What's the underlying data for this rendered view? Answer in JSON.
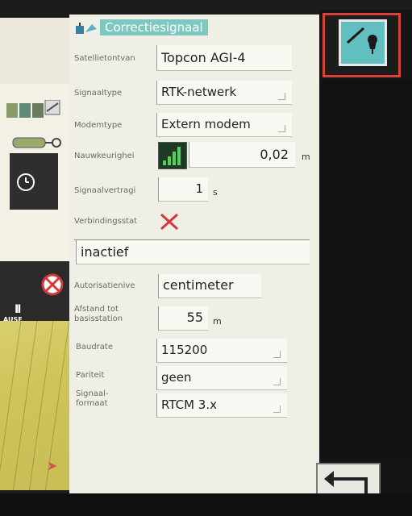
{
  "header": {
    "title": "Correctiesignaal",
    "icon": "satellite-antenna-icon"
  },
  "rows": {
    "receiver": {
      "label": "Satellietontvan",
      "value": "Topcon AGI-4"
    },
    "signal_type": {
      "label": "Signaaltype",
      "value": "RTK-netwerk"
    },
    "modem_type": {
      "label": "Modemtype",
      "value": "Extern modem"
    },
    "accuracy": {
      "label": "Nauwkeurighei",
      "value": "0,02",
      "unit": "m",
      "signal_bars": 4
    },
    "signal_delay": {
      "label": "Signaalvertragi",
      "value": "1",
      "unit": "s"
    },
    "connection_status": {
      "label": "Verbindingsstat",
      "status_icon": "red-x-icon",
      "text": "inactief"
    },
    "authorization_level": {
      "label": "Autorisatienive",
      "value": "centimeter"
    },
    "base_distance": {
      "label": "Afstand tot\nbasisstation",
      "label_line1": "Afstand tot",
      "label_line2": "basisstation",
      "value": "55",
      "unit": "m"
    },
    "baudrate": {
      "label": "Baudrate",
      "value": "115200"
    },
    "parity": {
      "label": "Pariteit",
      "value": "geen"
    },
    "signal_format": {
      "label_line1": "Signaal-",
      "label_line2": "formaat",
      "value": "RTCM 3.x"
    }
  },
  "left_strip": {
    "pause_label": "AUSE",
    "pause_symbol": "II"
  },
  "right_col": {
    "map_button_icon": "tree-map-icon",
    "back_button_icon": "back-arrow-icon"
  },
  "colors": {
    "title_bg": "#7fc8c0",
    "panel_bg": "#efefe6",
    "highlight_border": "#d8413a",
    "map_button_bg": "#62bfc0"
  }
}
